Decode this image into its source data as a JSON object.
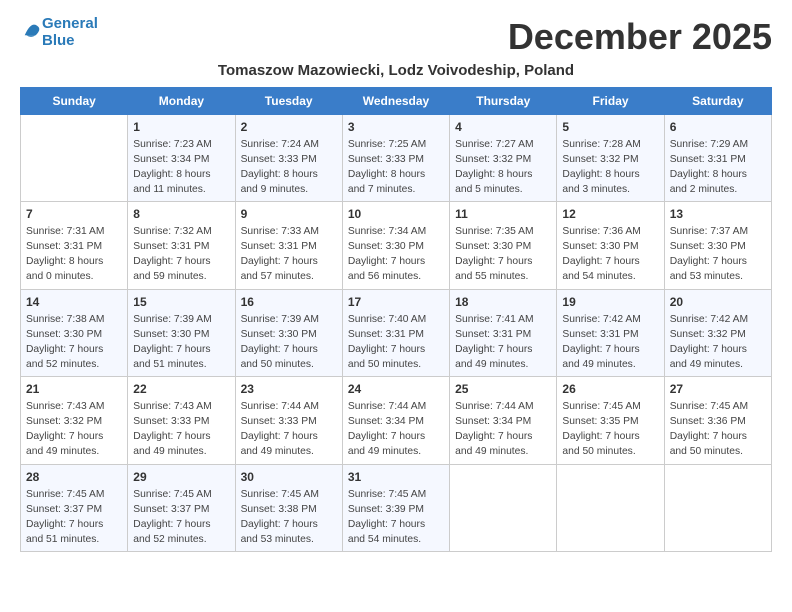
{
  "header": {
    "logo_line1": "General",
    "logo_line2": "Blue",
    "title": "December 2025",
    "subtitle": "Tomaszow Mazowiecki, Lodz Voivodeship, Poland"
  },
  "days_of_week": [
    "Sunday",
    "Monday",
    "Tuesday",
    "Wednesday",
    "Thursday",
    "Friday",
    "Saturday"
  ],
  "weeks": [
    [
      {
        "day": "",
        "content": ""
      },
      {
        "day": "1",
        "content": "Sunrise: 7:23 AM\nSunset: 3:34 PM\nDaylight: 8 hours\nand 11 minutes."
      },
      {
        "day": "2",
        "content": "Sunrise: 7:24 AM\nSunset: 3:33 PM\nDaylight: 8 hours\nand 9 minutes."
      },
      {
        "day": "3",
        "content": "Sunrise: 7:25 AM\nSunset: 3:33 PM\nDaylight: 8 hours\nand 7 minutes."
      },
      {
        "day": "4",
        "content": "Sunrise: 7:27 AM\nSunset: 3:32 PM\nDaylight: 8 hours\nand 5 minutes."
      },
      {
        "day": "5",
        "content": "Sunrise: 7:28 AM\nSunset: 3:32 PM\nDaylight: 8 hours\nand 3 minutes."
      },
      {
        "day": "6",
        "content": "Sunrise: 7:29 AM\nSunset: 3:31 PM\nDaylight: 8 hours\nand 2 minutes."
      }
    ],
    [
      {
        "day": "7",
        "content": "Sunrise: 7:31 AM\nSunset: 3:31 PM\nDaylight: 8 hours\nand 0 minutes."
      },
      {
        "day": "8",
        "content": "Sunrise: 7:32 AM\nSunset: 3:31 PM\nDaylight: 7 hours\nand 59 minutes."
      },
      {
        "day": "9",
        "content": "Sunrise: 7:33 AM\nSunset: 3:31 PM\nDaylight: 7 hours\nand 57 minutes."
      },
      {
        "day": "10",
        "content": "Sunrise: 7:34 AM\nSunset: 3:30 PM\nDaylight: 7 hours\nand 56 minutes."
      },
      {
        "day": "11",
        "content": "Sunrise: 7:35 AM\nSunset: 3:30 PM\nDaylight: 7 hours\nand 55 minutes."
      },
      {
        "day": "12",
        "content": "Sunrise: 7:36 AM\nSunset: 3:30 PM\nDaylight: 7 hours\nand 54 minutes."
      },
      {
        "day": "13",
        "content": "Sunrise: 7:37 AM\nSunset: 3:30 PM\nDaylight: 7 hours\nand 53 minutes."
      }
    ],
    [
      {
        "day": "14",
        "content": "Sunrise: 7:38 AM\nSunset: 3:30 PM\nDaylight: 7 hours\nand 52 minutes."
      },
      {
        "day": "15",
        "content": "Sunrise: 7:39 AM\nSunset: 3:30 PM\nDaylight: 7 hours\nand 51 minutes."
      },
      {
        "day": "16",
        "content": "Sunrise: 7:39 AM\nSunset: 3:30 PM\nDaylight: 7 hours\nand 50 minutes."
      },
      {
        "day": "17",
        "content": "Sunrise: 7:40 AM\nSunset: 3:31 PM\nDaylight: 7 hours\nand 50 minutes."
      },
      {
        "day": "18",
        "content": "Sunrise: 7:41 AM\nSunset: 3:31 PM\nDaylight: 7 hours\nand 49 minutes."
      },
      {
        "day": "19",
        "content": "Sunrise: 7:42 AM\nSunset: 3:31 PM\nDaylight: 7 hours\nand 49 minutes."
      },
      {
        "day": "20",
        "content": "Sunrise: 7:42 AM\nSunset: 3:32 PM\nDaylight: 7 hours\nand 49 minutes."
      }
    ],
    [
      {
        "day": "21",
        "content": "Sunrise: 7:43 AM\nSunset: 3:32 PM\nDaylight: 7 hours\nand 49 minutes."
      },
      {
        "day": "22",
        "content": "Sunrise: 7:43 AM\nSunset: 3:33 PM\nDaylight: 7 hours\nand 49 minutes."
      },
      {
        "day": "23",
        "content": "Sunrise: 7:44 AM\nSunset: 3:33 PM\nDaylight: 7 hours\nand 49 minutes."
      },
      {
        "day": "24",
        "content": "Sunrise: 7:44 AM\nSunset: 3:34 PM\nDaylight: 7 hours\nand 49 minutes."
      },
      {
        "day": "25",
        "content": "Sunrise: 7:44 AM\nSunset: 3:34 PM\nDaylight: 7 hours\nand 49 minutes."
      },
      {
        "day": "26",
        "content": "Sunrise: 7:45 AM\nSunset: 3:35 PM\nDaylight: 7 hours\nand 50 minutes."
      },
      {
        "day": "27",
        "content": "Sunrise: 7:45 AM\nSunset: 3:36 PM\nDaylight: 7 hours\nand 50 minutes."
      }
    ],
    [
      {
        "day": "28",
        "content": "Sunrise: 7:45 AM\nSunset: 3:37 PM\nDaylight: 7 hours\nand 51 minutes."
      },
      {
        "day": "29",
        "content": "Sunrise: 7:45 AM\nSunset: 3:37 PM\nDaylight: 7 hours\nand 52 minutes."
      },
      {
        "day": "30",
        "content": "Sunrise: 7:45 AM\nSunset: 3:38 PM\nDaylight: 7 hours\nand 53 minutes."
      },
      {
        "day": "31",
        "content": "Sunrise: 7:45 AM\nSunset: 3:39 PM\nDaylight: 7 hours\nand 54 minutes."
      },
      {
        "day": "",
        "content": ""
      },
      {
        "day": "",
        "content": ""
      },
      {
        "day": "",
        "content": ""
      }
    ]
  ]
}
